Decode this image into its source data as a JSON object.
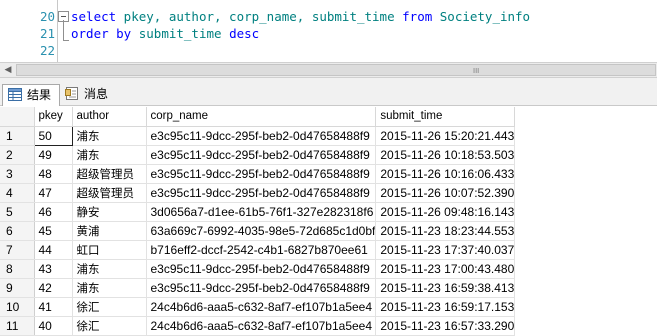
{
  "editor": {
    "lines": [
      {
        "number": "20",
        "segments": [
          {
            "t": "select",
            "kw": true
          },
          {
            "t": " pkey, author, corp_name, submit_time ",
            "kw": false
          },
          {
            "t": "from",
            "kw": true
          },
          {
            "t": " Society_info",
            "kw": false
          }
        ]
      },
      {
        "number": "21",
        "segments": [
          {
            "t": "order by",
            "kw": true
          },
          {
            "t": " submit_time ",
            "kw": false
          },
          {
            "t": "desc",
            "kw": true
          }
        ]
      },
      {
        "number": "22",
        "segments": []
      }
    ]
  },
  "colors": {
    "keyword": "#0000ff",
    "identifier": "#008080",
    "line_number": "#2b91af"
  },
  "scrollbar": {
    "left_arrow": "◀",
    "right_arrow": "▶",
    "grip": "III"
  },
  "tabs": [
    {
      "label": "结果",
      "icon": "grid-icon",
      "active": true
    },
    {
      "label": "消息",
      "icon": "message-icon",
      "active": false
    }
  ],
  "grid": {
    "columns": [
      "",
      "pkey",
      "author",
      "corp_name",
      "submit_time"
    ],
    "rows": [
      [
        "1",
        "50",
        "浦东",
        "e3c95c11-9dcc-295f-beb2-0d47658488f9",
        "2015-11-26 15:20:21.443"
      ],
      [
        "2",
        "49",
        "浦东",
        "e3c95c11-9dcc-295f-beb2-0d47658488f9",
        "2015-11-26 10:18:53.503"
      ],
      [
        "3",
        "48",
        "超级管理员",
        "e3c95c11-9dcc-295f-beb2-0d47658488f9",
        "2015-11-26 10:16:06.433"
      ],
      [
        "4",
        "47",
        "超级管理员",
        "e3c95c11-9dcc-295f-beb2-0d47658488f9",
        "2015-11-26 10:07:52.390"
      ],
      [
        "5",
        "46",
        "静安",
        "3d0656a7-d1ee-61b5-76f1-327e282318f6",
        "2015-11-26 09:48:16.143"
      ],
      [
        "6",
        "45",
        "黄浦",
        "63a669c7-6992-4035-98e5-72d685c1d0bf",
        "2015-11-23 18:23:44.553"
      ],
      [
        "7",
        "44",
        "虹口",
        "b716eff2-dccf-2542-c4b1-6827b870ee61",
        "2015-11-23 17:37:40.037"
      ],
      [
        "8",
        "43",
        "浦东",
        "e3c95c11-9dcc-295f-beb2-0d47658488f9",
        "2015-11-23 17:00:43.480"
      ],
      [
        "9",
        "42",
        "浦东",
        "e3c95c11-9dcc-295f-beb2-0d47658488f9",
        "2015-11-23 16:59:38.413"
      ],
      [
        "10",
        "41",
        "徐汇",
        "24c4b6d6-aaa5-c632-8af7-ef107b1a5ee4",
        "2015-11-23 16:59:17.153"
      ],
      [
        "11",
        "40",
        "徐汇",
        "24c4b6d6-aaa5-c632-8af7-ef107b1a5ee4",
        "2015-11-23 16:57:33.290"
      ]
    ],
    "selected_row": 0
  }
}
